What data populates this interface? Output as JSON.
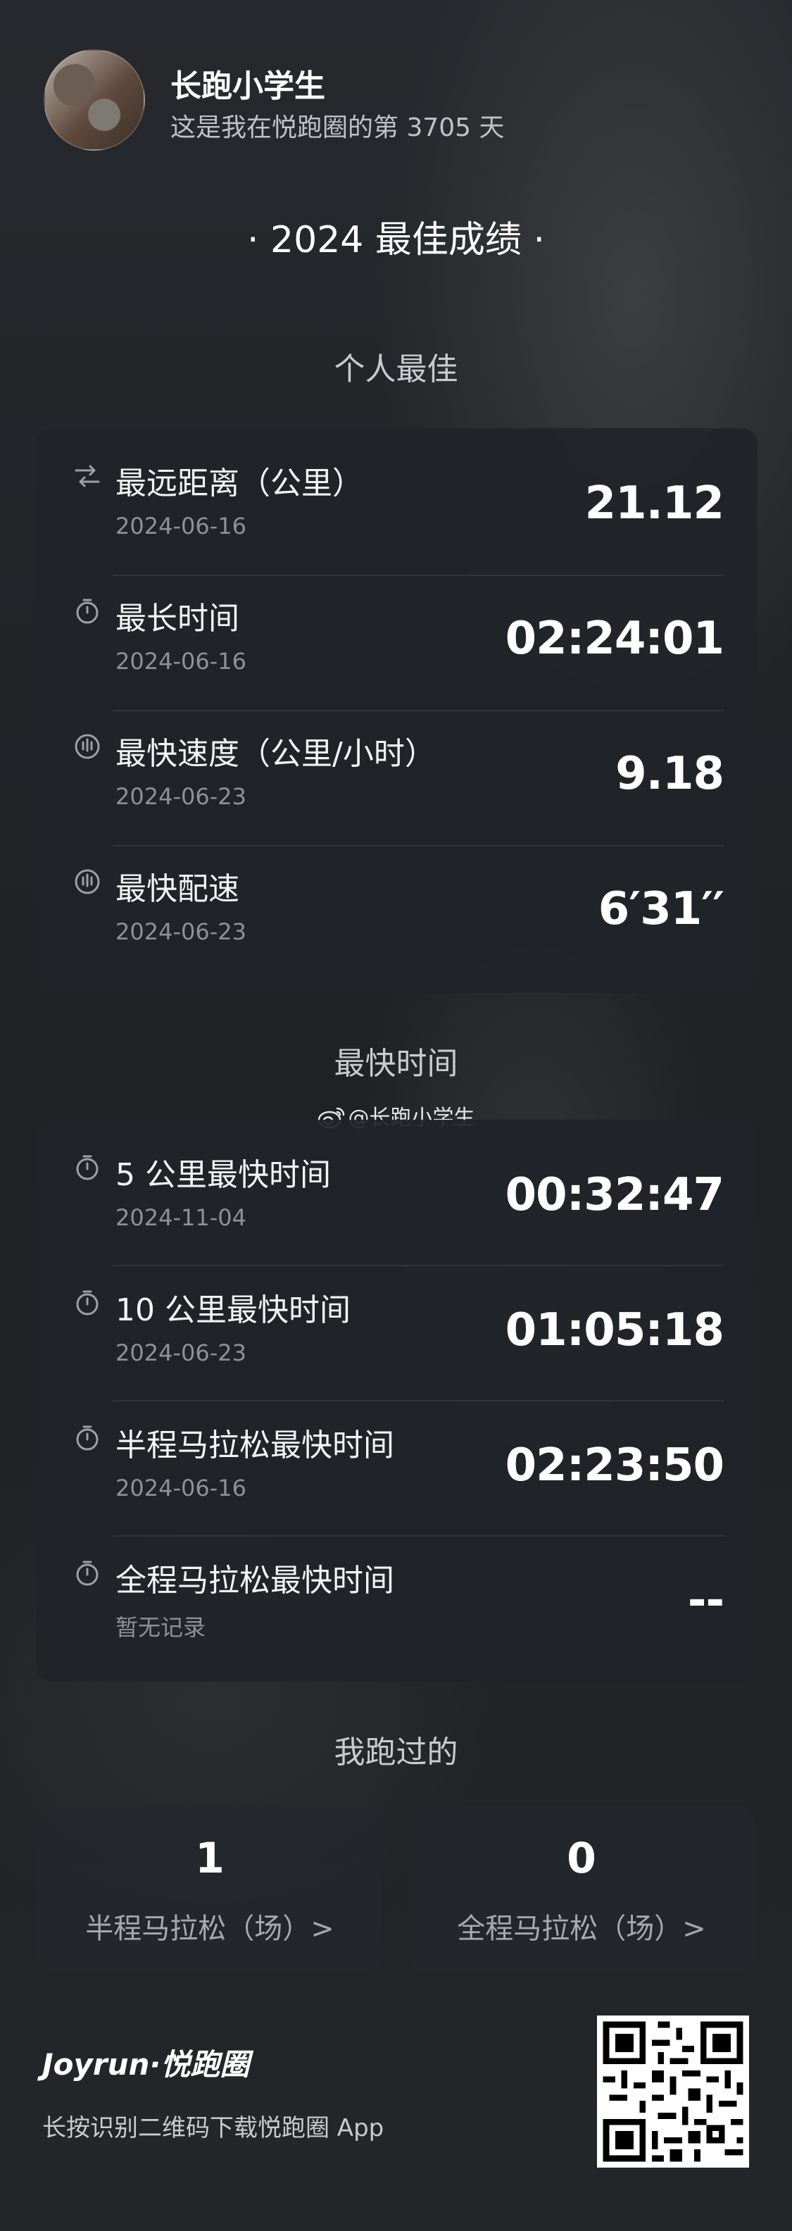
{
  "header": {
    "username": "长跑小学生",
    "subtitle": "这是我在悦跑圈的第 3705 天"
  },
  "page_title": "· 2024 最佳成绩 ·",
  "personal_best": {
    "title": "个人最佳",
    "rows": [
      {
        "icon": "route-icon",
        "label": "最远距离（公里）",
        "date": "2024-06-16",
        "value": "21.12"
      },
      {
        "icon": "stopwatch-icon",
        "label": "最长时间",
        "date": "2024-06-16",
        "value": "02:24:01"
      },
      {
        "icon": "speed-icon",
        "label": "最快速度（公里/小时）",
        "date": "2024-06-23",
        "value": "9.18"
      },
      {
        "icon": "speed-icon",
        "label": "最快配速",
        "date": "2024-06-23",
        "value": "6′31′′"
      }
    ]
  },
  "fastest_time": {
    "title": "最快时间",
    "watermark": "@长跑小学生",
    "rows": [
      {
        "icon": "stopwatch-icon",
        "label": "5 公里最快时间",
        "date": "2024-11-04",
        "value": "00:32:47"
      },
      {
        "icon": "stopwatch-icon",
        "label": "10 公里最快时间",
        "date": "2024-06-23",
        "value": "01:05:18"
      },
      {
        "icon": "stopwatch-icon",
        "label": "半程马拉松最快时间",
        "date": "2024-06-16",
        "value": "02:23:50"
      },
      {
        "icon": "stopwatch-icon",
        "label": "全程马拉松最快时间",
        "date": "暂无记录",
        "value": "--"
      }
    ]
  },
  "races": {
    "title": "我跑过的",
    "cards": [
      {
        "count": "1",
        "label": "半程马拉松（场）>"
      },
      {
        "count": "0",
        "label": "全程马拉松（场）>"
      }
    ]
  },
  "footer": {
    "brand": "Joyrun·悦跑圈",
    "text": "长按识别二维码下载悦跑圈 App"
  }
}
